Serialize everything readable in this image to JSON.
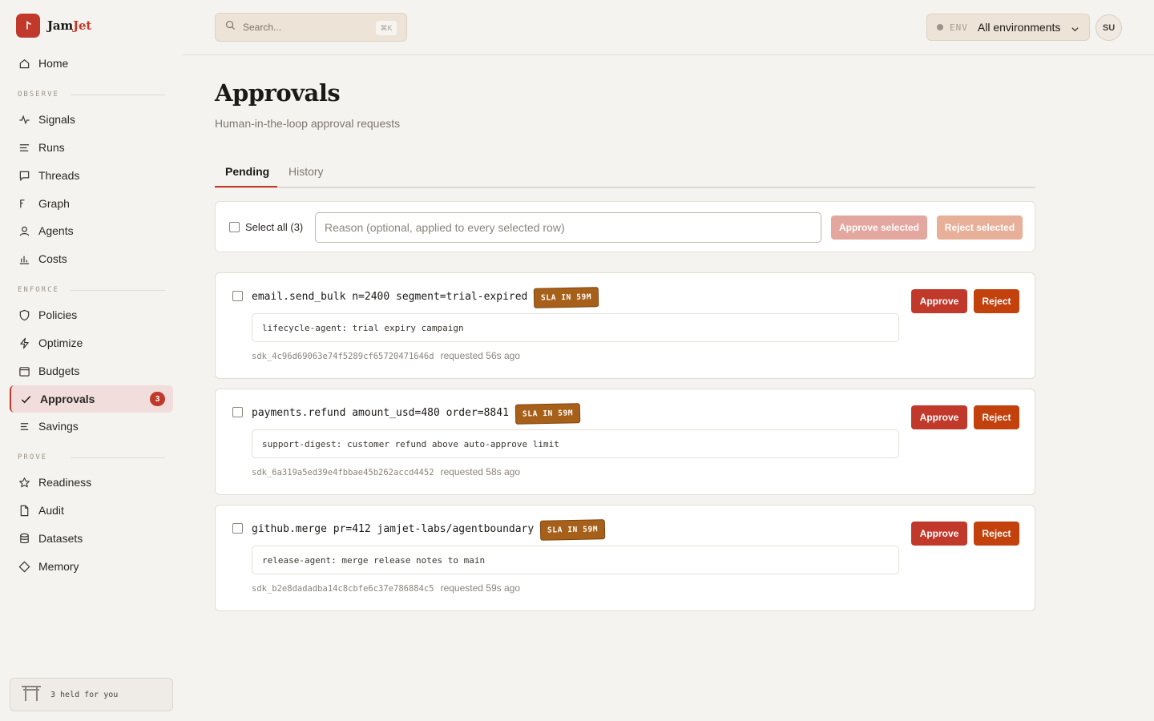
{
  "brand": {
    "name_part1": "Jam",
    "name_part2": "Jet"
  },
  "sidebar": {
    "items": [
      {
        "label": "Home",
        "icon": "home-icon"
      },
      {
        "label": "Signals",
        "icon": "pulse-icon"
      },
      {
        "label": "Runs",
        "icon": "list-icon"
      },
      {
        "label": "Threads",
        "icon": "chat-icon"
      },
      {
        "label": "Graph",
        "icon": "graph-icon"
      },
      {
        "label": "Agents",
        "icon": "user-icon"
      },
      {
        "label": "Costs",
        "icon": "bar-chart-icon"
      },
      {
        "label": "Policies",
        "icon": "shield-icon"
      },
      {
        "label": "Optimize",
        "icon": "bolt-icon"
      },
      {
        "label": "Budgets",
        "icon": "wallet-icon"
      },
      {
        "label": "Approvals",
        "icon": "check-icon",
        "badge": "3",
        "active": true
      },
      {
        "label": "Savings",
        "icon": "lines-icon"
      },
      {
        "label": "Readiness",
        "icon": "star-icon"
      },
      {
        "label": "Audit",
        "icon": "document-icon"
      },
      {
        "label": "Datasets",
        "icon": "database-icon"
      },
      {
        "label": "Memory",
        "icon": "tag-icon"
      }
    ],
    "sections": {
      "observe": "OBSERVE",
      "enforce": "ENFORCE",
      "prove": "PROVE"
    },
    "held_text": "3 held for you"
  },
  "header": {
    "search_placeholder": "Search...",
    "search_shortcut": "⌘K",
    "env_label": "ENV",
    "env_value": "All environments",
    "avatar_initials": "SU"
  },
  "page": {
    "title": "Approvals",
    "subtitle": "Human-in-the-loop approval requests",
    "tabs": [
      "Pending",
      "History"
    ],
    "active_tab": "Pending"
  },
  "bulk": {
    "select_all_label": "Select all (3)",
    "reason_placeholder": "Reason (optional, applied to every selected row)",
    "approve_selected": "Approve selected",
    "reject_selected": "Reject selected"
  },
  "approvals": [
    {
      "title": "email.send_bulk n=2400 segment=trial-expired",
      "sla": "SLA IN 59M",
      "reason": "lifecycle-agent: trial expiry campaign",
      "id": "sdk_4c96d69063e74f5289cf65720471646d",
      "requested": "requested 56s ago"
    },
    {
      "title": "payments.refund amount_usd=480 order=8841",
      "sla": "SLA IN 59M",
      "reason": "support-digest: customer refund above auto-approve limit",
      "id": "sdk_6a319a5ed39e4fbbae45b262accd4452",
      "requested": "requested 58s ago"
    },
    {
      "title": "github.merge pr=412 jamjet-labs/agentboundary",
      "sla": "SLA IN 59M",
      "reason": "release-agent: merge release notes to main",
      "id": "sdk_b2e8dadadba14c8cbfe6c37e786884c5",
      "requested": "requested 59s ago"
    }
  ],
  "actions": {
    "approve": "Approve",
    "reject": "Reject"
  },
  "colors": {
    "accent": "#c0392b",
    "reject": "#c2410c",
    "sla": "#a6601a",
    "background": "#f5f3ef"
  }
}
